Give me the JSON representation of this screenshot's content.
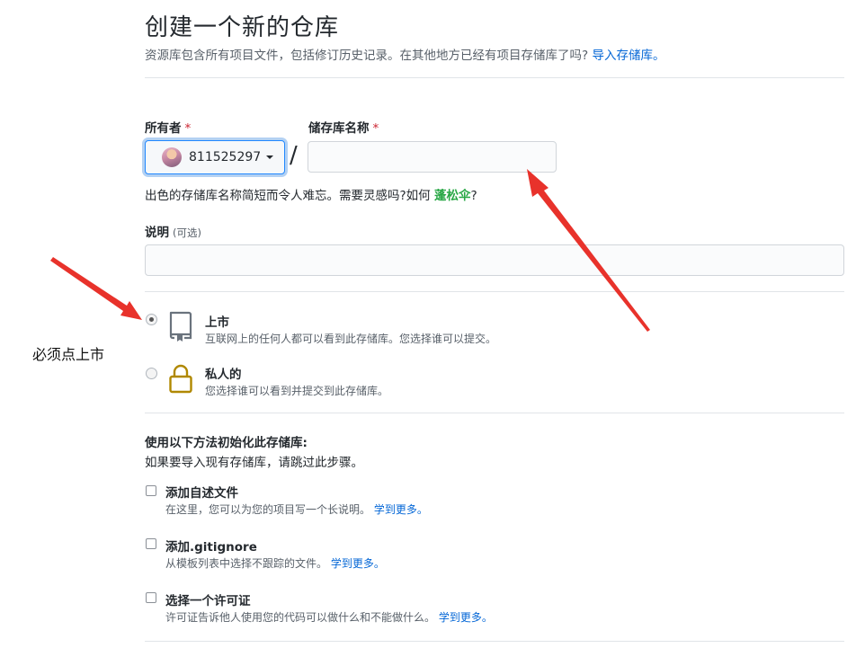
{
  "header": {
    "title": "创建一个新的仓库",
    "subtitle": "资源库包含所有项目文件，包括修订历史记录。在其他地方已经有项目存储库了吗?",
    "import_link": "导入存储库。"
  },
  "owner": {
    "label": "所有者",
    "required_mark": "*",
    "value": "811525297"
  },
  "repo_name": {
    "label": "储存库名称",
    "required_mark": "*",
    "value": "",
    "separator": "/"
  },
  "hint": {
    "text": "出色的存储库名称简短而令人难忘。需要灵感吗?如何",
    "suggestion": "蓬松伞",
    "suffix": "?"
  },
  "description": {
    "label": "说明",
    "optional": "(可选)",
    "value": ""
  },
  "visibility": {
    "public": {
      "title": "上市",
      "note": "互联网上的任何人都可以看到此存储库。您选择谁可以提交。",
      "checked": true,
      "icon": "repo-icon"
    },
    "private": {
      "title": "私人的",
      "note": "您选择谁可以看到并提交到此存储库。",
      "checked": false,
      "icon": "lock-icon"
    }
  },
  "init": {
    "heading": "使用以下方法初始化此存储库:",
    "subheading": "如果要导入现有存储库，请跳过此步骤。",
    "options": [
      {
        "title": "添加自述文件",
        "note": "在这里，您可以为您的项目写一个长说明。",
        "link": "学到更多。"
      },
      {
        "title": "添加.gitignore",
        "note": "从模板列表中选择不跟踪的文件。",
        "link": "学到更多。"
      },
      {
        "title": "选择一个许可证",
        "note": "许可证告诉他人使用您的代码可以做什么和不能做什么。",
        "link": "学到更多。"
      }
    ]
  },
  "annotation": {
    "text": "必须点上市"
  },
  "colors": {
    "link": "#0366d6",
    "required": "#cb2431",
    "suggestion": "#28a745",
    "arrow": "#e8322b",
    "lock": "#b08800"
  }
}
